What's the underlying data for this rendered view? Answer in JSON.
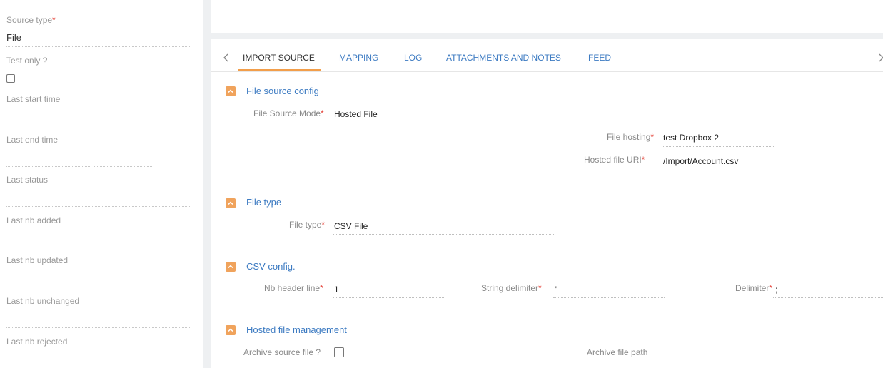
{
  "left_panel": {
    "source_type": {
      "label": "Source type",
      "value": "File"
    },
    "test_only": {
      "label": "Test only ?"
    },
    "last_start_time": {
      "label": "Last start time"
    },
    "last_end_time": {
      "label": "Last end time"
    },
    "last_status": {
      "label": "Last status"
    },
    "last_nb_added": {
      "label": "Last nb added"
    },
    "last_nb_updated": {
      "label": "Last nb updated"
    },
    "last_nb_unchanged": {
      "label": "Last nb unchanged"
    },
    "last_nb_rejected": {
      "label": "Last nb rejected"
    }
  },
  "tabs": {
    "back_icon": "chevron-left-icon",
    "items": [
      "IMPORT SOURCE",
      "MAPPING",
      "LOG",
      "ATTACHMENTS AND NOTES",
      "FEED"
    ],
    "active": "IMPORT SOURCE",
    "accent_color": "#f29e4a",
    "link_color": "#3d7bc2"
  },
  "sections": {
    "file_source_config": {
      "title": "File source config",
      "file_source_mode": {
        "label": "File Source Mode",
        "value": "Hosted File"
      },
      "file_hosting": {
        "label": "File hosting",
        "value": "test Dropbox 2"
      },
      "hosted_file_uri": {
        "label": "Hosted file URI",
        "value": "/Import/Account.csv"
      }
    },
    "file_type": {
      "title": "File type",
      "file_type": {
        "label": "File type",
        "value": "CSV File"
      }
    },
    "csv_config": {
      "title": "CSV config.",
      "nb_header_line": {
        "label": "Nb header line",
        "value": "1"
      },
      "string_delimiter": {
        "label": "String delimiter",
        "value": "\""
      },
      "delimiter": {
        "label": "Delimiter",
        "value": ";"
      }
    },
    "hosted_file_management": {
      "title": "Hosted file management",
      "archive_source_file": {
        "label": "Archive source file ?"
      },
      "archive_file_path": {
        "label": "Archive file path",
        "value": ""
      }
    }
  },
  "required_marker": "*",
  "colors": {
    "section_toggle": "#f0a35c",
    "required": "#e5453b",
    "background_gap": "#eef0f2"
  }
}
